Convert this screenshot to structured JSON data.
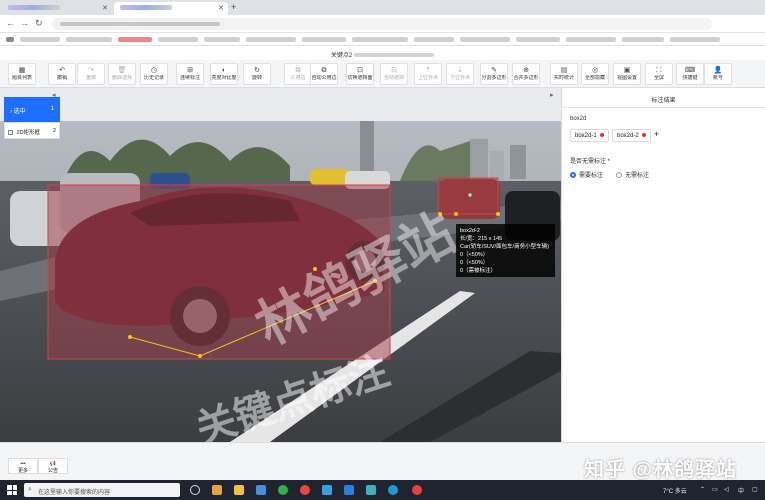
{
  "browser": {
    "tabs": [
      {
        "label": ""
      },
      {
        "label": ""
      }
    ],
    "url": ""
  },
  "app": {
    "title_prefix": "关键点2"
  },
  "toolbar": [
    {
      "icon": "▦",
      "label": "题目列表"
    },
    {
      "icon": "↶",
      "label": "撤销"
    },
    {
      "icon": "↷",
      "label": "重做"
    },
    {
      "icon": "🗑",
      "label": "删除选择"
    },
    {
      "icon": "◷",
      "label": "历史记录"
    },
    {
      "icon": "⊞",
      "label": "连续标注"
    },
    {
      "icon": "◐",
      "label": "亮度对比度"
    },
    {
      "icon": "↻",
      "label": "旋转"
    },
    {
      "icon": "⧉",
      "label": "公用边"
    },
    {
      "icon": "⧉",
      "label": "自动公用边"
    },
    {
      "icon": "⊡",
      "label": "切换遮挡面"
    },
    {
      "icon": "⊟",
      "label": "自动遮挡"
    },
    {
      "icon": "⇡",
      "label": "上位界点"
    },
    {
      "icon": "⇣",
      "label": "下位界点"
    },
    {
      "icon": "✎",
      "label": "分割多边形"
    },
    {
      "icon": "⊕",
      "label": "合并多边形"
    },
    {
      "icon": "▤",
      "label": "实时统计"
    },
    {
      "icon": "◎",
      "label": "全部隐藏"
    },
    {
      "icon": "▣",
      "label": "视图设置"
    },
    {
      "icon": "⛶",
      "label": "全屏"
    },
    {
      "icon": "⌨",
      "label": "快捷键"
    },
    {
      "icon": "👤",
      "label": "账号"
    }
  ],
  "left_list": {
    "selected": {
      "label": "选中",
      "count": "1"
    },
    "items": [
      {
        "label": "2D矩形框",
        "count": "2"
      }
    ]
  },
  "tooltip": {
    "name": "box2d-2",
    "size": "长/宽：215 x 145",
    "category": "Car(轿车/SUV/面包车/商务小型车辆)",
    "attr1": "0（<50%）",
    "attr2": "0（<50%）",
    "attr3": "0（需被标注）"
  },
  "right_panel": {
    "title": "标注结果",
    "section_label": "box2d",
    "boxes": [
      "box2d-1",
      "box2d-2"
    ],
    "add_label": "+",
    "question": "是否无需标注 *",
    "options": [
      "需要标注",
      "无需标注"
    ],
    "selected_option": "需要标注"
  },
  "image_watermark": {
    "line1": "林鸽驿站",
    "line2": "关键点标注"
  },
  "bottom": {
    "buttons": [
      {
        "icon": "•••",
        "label": "更多"
      },
      {
        "icon": "📢",
        "label": "公告"
      }
    ]
  },
  "zhihu_watermark": "知乎 @林鸽驿站",
  "taskbar": {
    "search_placeholder": "在这里输入你要搜索的内容",
    "weather": "7°C 多云",
    "ime": "中"
  },
  "colors": {
    "accent": "#1e6fff",
    "box_overlay": "#a33a48",
    "keypoint": "#f5c518"
  }
}
